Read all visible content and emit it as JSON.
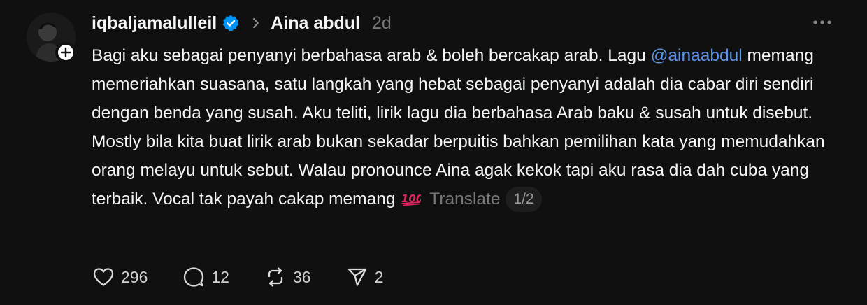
{
  "post": {
    "author": "iqbaljamalulleil",
    "reply_to": "Aina abdul",
    "time": "2d",
    "text": {
      "part1": "Bagi aku sebagai penyanyi berbahasa arab & boleh bercakap arab. Lagu ",
      "mention": "@ainaabdul",
      "part2": " memang memeriahkan suasana, satu langkah yang hebat sebagai penyanyi adalah dia cabar diri sendiri dengan benda yang susah. Aku teliti, lirik lagu dia berbahasa Arab baku & susah untuk disebut. Mostly bila kita buat lirik arab bukan sekadar berpuitis bahkan pemilihan kata yang memudahkan orang melayu untuk sebut. Walau pronounce Aina agak kekok tapi aku rasa dia dah cuba yang terbaik. Vocal tak payah cakap memang "
    },
    "emoji": "100",
    "translate_label": "Translate",
    "page_indicator": "1/2"
  },
  "actions": {
    "likes": "296",
    "replies": "12",
    "reposts": "36",
    "shares": "2"
  },
  "icons": {
    "verified": "verified-badge-icon",
    "chevron": "chevron-right-icon",
    "more": "more-dots-icon",
    "like": "heart-icon",
    "reply": "comment-icon",
    "repost": "repost-icon",
    "share": "share-icon",
    "follow": "plus-icon"
  },
  "colors": {
    "background": "#101010",
    "text": "#f3f5f7",
    "muted": "#777777",
    "mention": "#5b95e7",
    "verified": "#0095f6",
    "emoji": "#e0245e"
  }
}
